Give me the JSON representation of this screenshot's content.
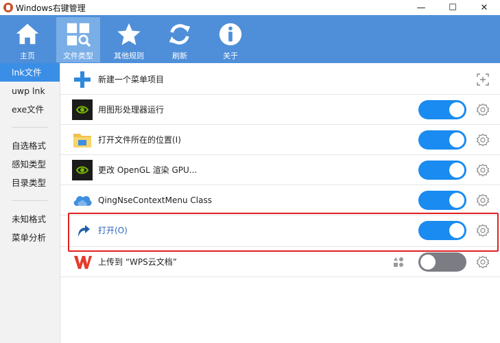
{
  "window": {
    "title": "Windows右键管理",
    "controls": {
      "minimize": "—",
      "maximize": "☐",
      "close": "✕"
    }
  },
  "toolbar": {
    "items": [
      {
        "label": "主页",
        "icon": "home-icon",
        "active": false
      },
      {
        "label": "文件类型",
        "icon": "file-type-icon",
        "active": true
      },
      {
        "label": "其他规则",
        "icon": "star-icon",
        "active": false
      },
      {
        "label": "刷新",
        "icon": "refresh-icon",
        "active": false
      },
      {
        "label": "关于",
        "icon": "info-icon",
        "active": false
      }
    ]
  },
  "sidebar": {
    "groups": [
      [
        {
          "label": "lnk文件",
          "active": true
        },
        {
          "label": "uwp lnk"
        },
        {
          "label": "exe文件"
        }
      ],
      [
        {
          "label": "自选格式"
        },
        {
          "label": "感知类型"
        },
        {
          "label": "目录类型"
        }
      ],
      [
        {
          "label": "未知格式"
        },
        {
          "label": "菜单分析"
        }
      ]
    ]
  },
  "main": {
    "new_item": {
      "label": "新建一个菜单项目",
      "icon": "add-item-icon"
    },
    "rows": [
      {
        "label": "用图形处理器运行",
        "icon": "nvidia-icon",
        "enabled": true
      },
      {
        "label": "打开文件所在的位置(I)",
        "icon": "folder-icon",
        "enabled": true
      },
      {
        "label": "更改 OpenGL 渲染 GPU...",
        "icon": "nvidia-icon",
        "enabled": true
      },
      {
        "label": "QingNseContextMenu Class",
        "icon": "cloud-icon",
        "enabled": true
      },
      {
        "label": "打开(O)",
        "icon": "shortcut-arrow-icon",
        "enabled": true,
        "highlighted": true
      },
      {
        "label": "上传到 “WPS云文档”",
        "icon": "wps-icon",
        "enabled": false
      }
    ]
  },
  "colors": {
    "toolbar_bg": "#4f8fd9",
    "accent": "#1a8bf0",
    "highlight_border": "#e02020"
  }
}
